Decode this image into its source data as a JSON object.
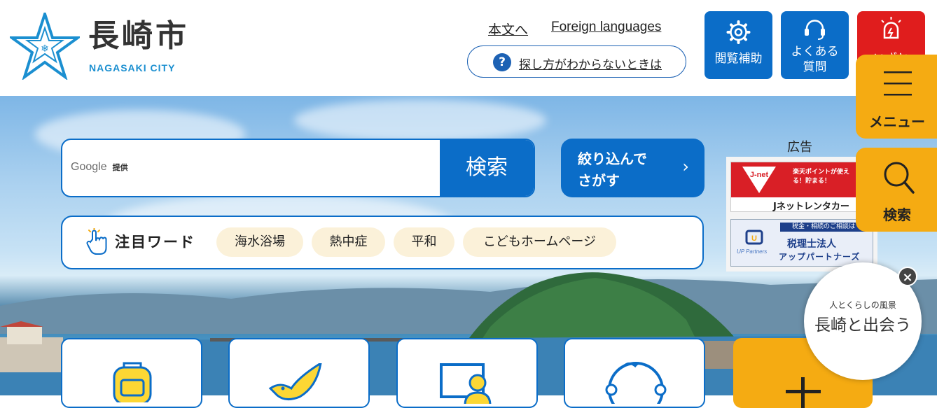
{
  "header": {
    "logo_jp": "長崎市",
    "logo_en": "NAGASAKI CITY",
    "link_main": "本文へ",
    "link_foreign": "Foreign languages",
    "help_text": "探し方がわからないときは",
    "buttons": [
      {
        "label": "閲覧補助",
        "icon": "gear-icon"
      },
      {
        "label": "よくある\n質問",
        "icon": "headset-icon"
      },
      {
        "label": "いざと",
        "icon": "alarm-icon"
      }
    ]
  },
  "search": {
    "provider": "Google",
    "provider_suffix": "提供",
    "button": "検索",
    "refine_line1": "絞り込んで",
    "refine_line2": "さがす"
  },
  "attention_words": {
    "title": "注目ワード",
    "chips": [
      "海水浴場",
      "熱中症",
      "平和",
      "こどもホームページ"
    ]
  },
  "ads": {
    "label": "広告",
    "ad1_title": "Jネットレンタカー",
    "ad1_badge": "楽天ポイントが使える！貯まる！",
    "ad1_logo": "J-net",
    "ad2_top": "税金・相続のご相談は",
    "ad2_line1": "税理士法人",
    "ad2_line2": "アップパートナーズ",
    "ad2_logo": "UP Partners"
  },
  "side_menu": {
    "menu_label": "メニュー",
    "search_label": "検索"
  },
  "promo": {
    "sub": "人とくらしの風景",
    "main": "長崎と出会う",
    "close": "×"
  },
  "colors": {
    "brand_blue": "#0b6dc8",
    "orange": "#f5ab12",
    "alert_red": "#e01d1d",
    "chip_bg": "#fbf1d9"
  }
}
